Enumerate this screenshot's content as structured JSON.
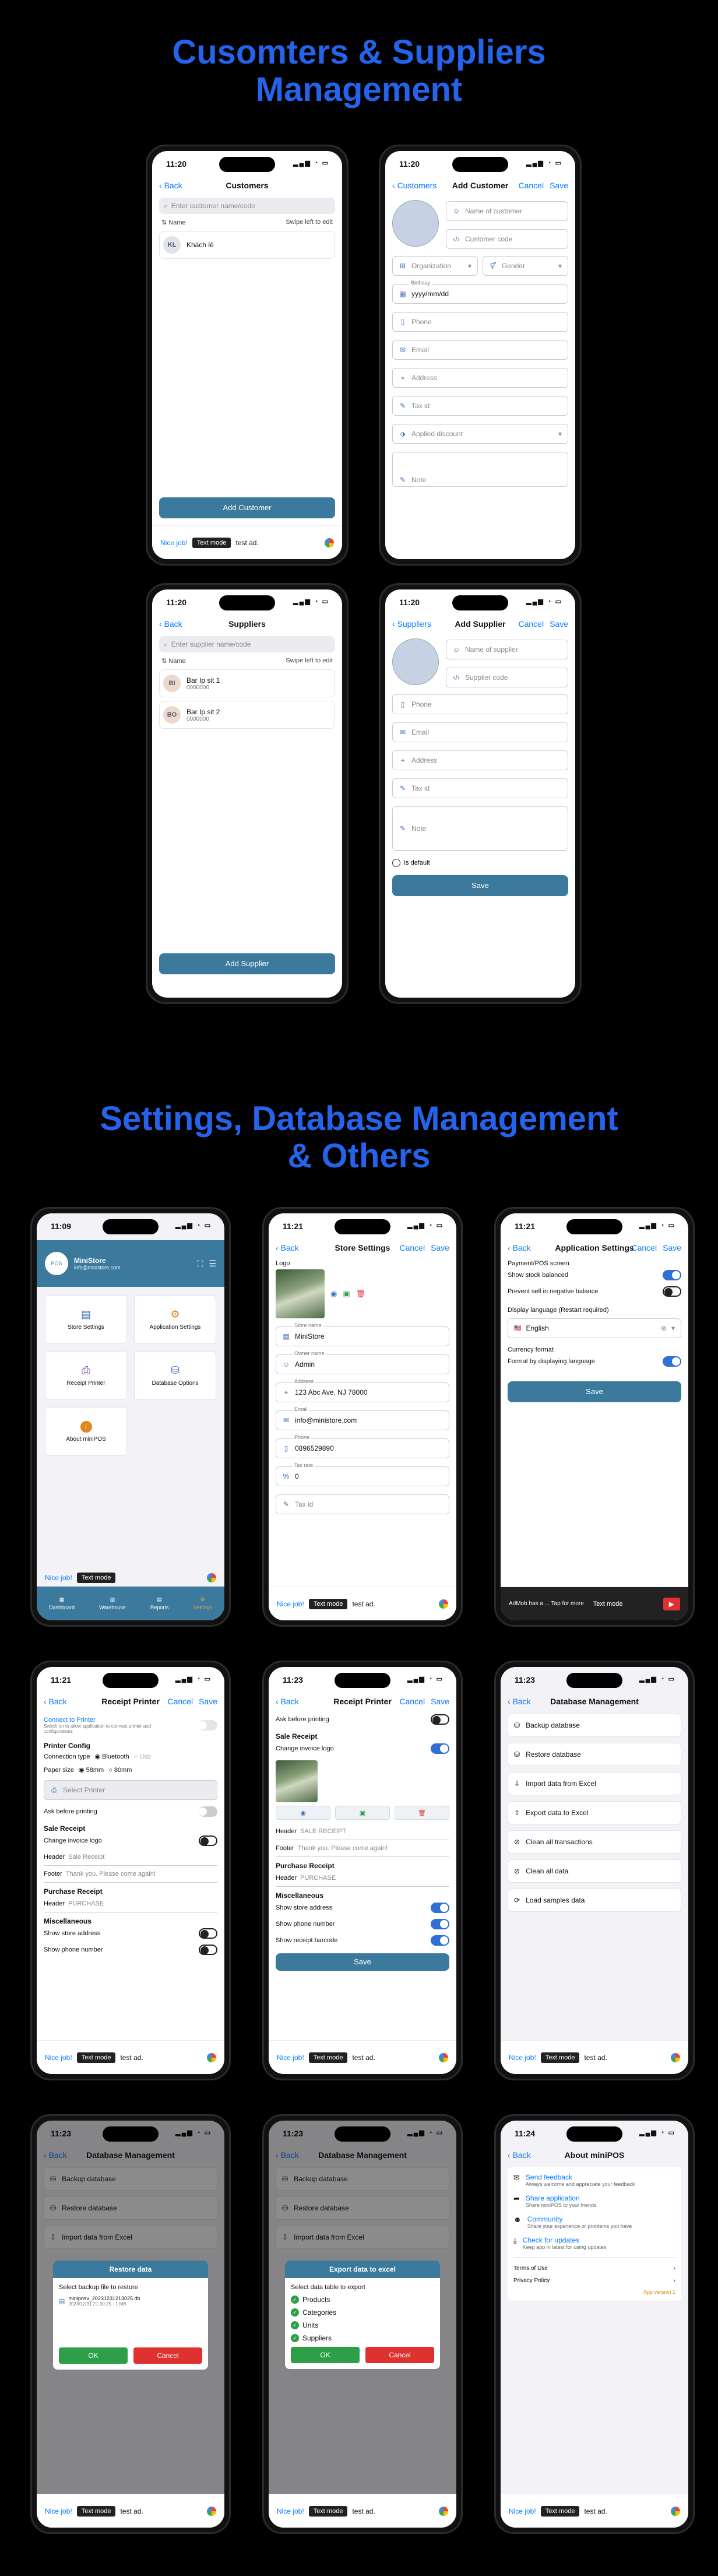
{
  "headings": {
    "customers": "Cusomters & Suppliers\nManagement",
    "settings": "Settings, Database Management\n& Others"
  },
  "common": {
    "back": "Back",
    "cancel": "Cancel",
    "save": "Save",
    "nice_job": "Nice job!",
    "text_mode": "Text mode",
    "test_ad": "test ad."
  },
  "customers_list": {
    "time": "11:20",
    "title": "Customers",
    "search_placeholder": "Enter customer name/code",
    "name_col": "Name",
    "swipe_hint": "Swipe left to edit",
    "items": [
      {
        "initials": "KL",
        "name": "Khách lẻ"
      }
    ],
    "add_button": "Add Customer"
  },
  "add_customer": {
    "time": "11:20",
    "back": "Customers",
    "title": "Add Customer",
    "name_placeholder": "Name of customer",
    "code_placeholder": "Customer code",
    "organization": "Organization",
    "gender": "Gender",
    "birthday_label": "Birthday",
    "birthday_placeholder": "yyyy/mm/dd",
    "phone": "Phone",
    "email": "Email",
    "address": "Address",
    "tax_id": "Tax id",
    "discount": "Applied discount",
    "note": "Note"
  },
  "suppliers_list": {
    "time": "11:20",
    "title": "Suppliers",
    "search_placeholder": "Enter supplier name/code",
    "name_col": "Name",
    "swipe_hint": "Swipe left to edit",
    "items": [
      {
        "initials": "BI",
        "name": "Bar Ip sit 1",
        "sub": "0000000"
      },
      {
        "initials": "BO",
        "name": "Bar Ip sit 2",
        "sub": "0000000"
      }
    ],
    "add_button": "Add Supplier"
  },
  "add_supplier": {
    "time": "11:20",
    "back": "Suppliers",
    "title": "Add Supplier",
    "name_placeholder": "Name of supplier",
    "code_placeholder": "Supplier code",
    "phone": "Phone",
    "email": "Email",
    "address": "Address",
    "tax_id": "Tax id",
    "note": "Note",
    "is_default": "Is default",
    "save_button": "Save"
  },
  "home": {
    "time": "11:09",
    "store_name": "MiniStore",
    "store_sub": "info@ministore.com",
    "cards": [
      "Store Settings",
      "Application Settings",
      "Receipt Printer",
      "Database Options",
      "About miniPOS"
    ],
    "tabs": [
      "Dashboard",
      "Warehouse",
      "Reports",
      "Settings"
    ]
  },
  "store_settings": {
    "time": "11:21",
    "title": "Store Settings",
    "logo_label": "Logo",
    "store_name_label": "Store name",
    "store_name": "MiniStore",
    "owner_label": "Owner name",
    "owner": "Admin",
    "address_label": "Address",
    "address": "123 Abc Ave, NJ 78000",
    "email_label": "Email",
    "email": "info@ministore.com",
    "phone_label": "Phone",
    "phone": "0896529890",
    "tax_label": "Tax rate",
    "tax": "0",
    "tax_id": "Tax id"
  },
  "app_settings": {
    "time": "11:21",
    "title": "Application Settings",
    "pos_section": "Payment/POS screen",
    "show_stock": "Show stock balanced",
    "prevent_negative": "Prevent sell in negative balance",
    "display_lang": "Display language (Restart required)",
    "language": "English",
    "currency": "Currency format",
    "currency_opt": "Format by displaying language",
    "save_button": "Save",
    "ad_text": "AdMob has a ... Tap for more"
  },
  "receipt_printer_1": {
    "time": "11:21",
    "title": "Receipt Printer",
    "connect": "Connect to Printer",
    "connect_sub": "Switch on to allow application to connect printer and configurations",
    "config": "Printer Config",
    "conn_type": "Connection type",
    "bluetooth": "Bluetooth",
    "usb": "Usb",
    "paper": "Paper size",
    "p58": "58mm",
    "p80": "80mm",
    "select_printer": "Select Printer",
    "ask_before": "Ask before printing",
    "sale_receipt": "Sale Receipt",
    "change_logo": "Change invoice logo",
    "header_label": "Header",
    "header_val": "Sale Receipt",
    "footer_label": "Footer",
    "footer_val": "Thank you. Please come again!",
    "purchase_receipt": "Purchase Receipt",
    "purchase_header": "PURCHASE",
    "misc": "Miscellaneous",
    "show_address": "Show store address",
    "show_phone": "Show phone number"
  },
  "receipt_printer_2": {
    "time": "11:23",
    "title": "Receipt Printer",
    "ask_before": "Ask before printing",
    "sale_receipt": "Sale Receipt",
    "change_logo": "Change invoice logo",
    "header_label": "Header",
    "header_val": "SALE RECEIPT",
    "footer_label": "Footer",
    "footer_val": "Thank you. Please come again!",
    "purchase_receipt": "Purchase Receipt",
    "purchase_label": "Header",
    "purchase_header": "PURCHASE",
    "misc": "Miscellaneous",
    "show_address": "Show store address",
    "show_phone": "Show phone number",
    "show_barcode": "Show receipt barcode",
    "save_button": "Save"
  },
  "database": {
    "time": "11:23",
    "title": "Database Management",
    "items": [
      "Backup database",
      "Restore database",
      "Import data from Excel",
      "Export data to Excel",
      "Clean all transactions",
      "Clean all data",
      "Load samples data"
    ]
  },
  "restore_dialog": {
    "time": "11:23",
    "title": "Restore data",
    "prompt": "Select backup file to restore",
    "file_name": "miniposv_20231231213025.db",
    "file_meta": "2023/12/31 21:30:25 - 1 MB",
    "ok": "OK",
    "cancel": "Cancel"
  },
  "export_dialog": {
    "time": "11:23",
    "title": "Export data to excel",
    "prompt": "Select data table to export",
    "items": [
      "Products",
      "Categories",
      "Units",
      "Suppliers"
    ],
    "ok": "OK",
    "cancel": "Cancel"
  },
  "about": {
    "time": "11:24",
    "title": "About miniPOS",
    "items": [
      {
        "title": "Send feedback",
        "desc": "Always welcome and appreciate your feedback"
      },
      {
        "title": "Share application",
        "desc": "Share miniPOS to your friends"
      },
      {
        "title": "Community",
        "desc": "Share your experience or problems you have"
      },
      {
        "title": "Check for updates",
        "desc": "Keep app in latest for using updates"
      }
    ],
    "terms": "Terms of Use",
    "privacy": "Privacy Policy",
    "version": "App version 1"
  }
}
